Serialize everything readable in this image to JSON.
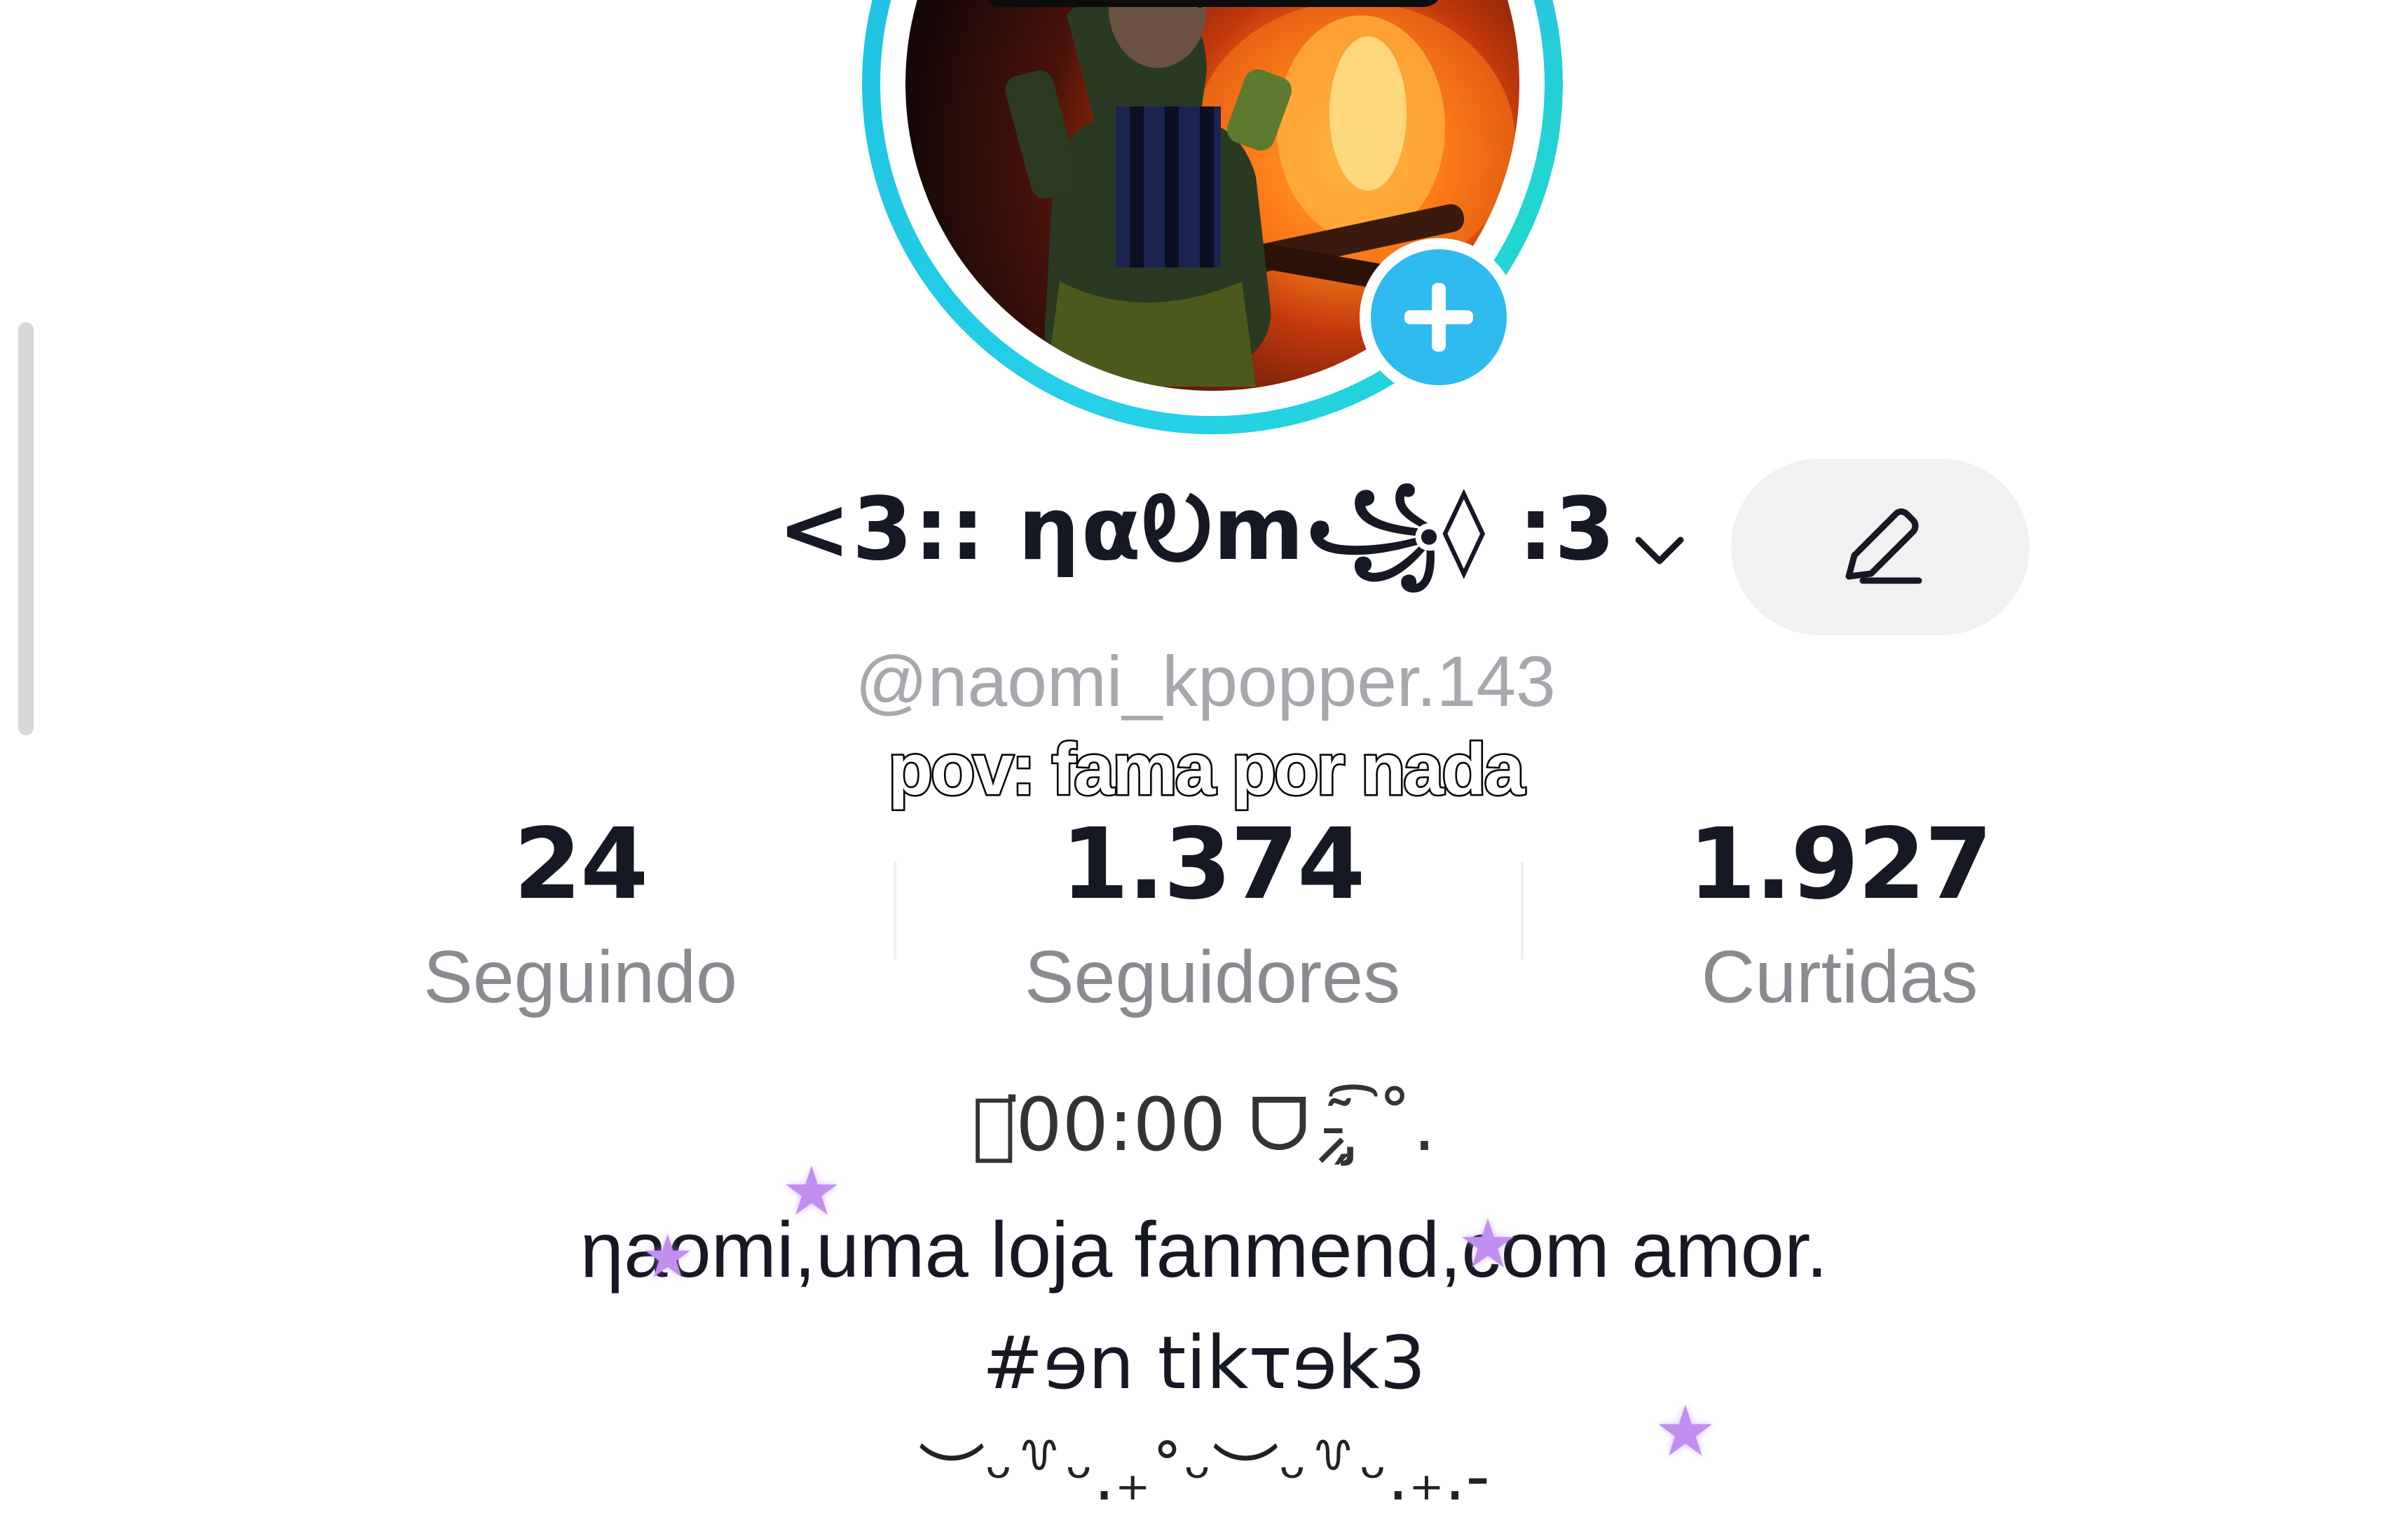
{
  "profile": {
    "display_name": "<3:: ηαᎧm꧁◊ :3",
    "username": "@naomi_kpopper.143",
    "add_icon": "plus-icon",
    "edit_icon": "pencil-icon",
    "dropdown_icon": "chevron-down-icon"
  },
  "caption": {
    "text": "pov: fama por nada"
  },
  "stats": {
    "following": {
      "value": "24",
      "label": "Seguindo"
    },
    "followers": {
      "value": "1.374",
      "label": "Seguidores"
    },
    "likes": {
      "value": "1.927",
      "label": "Curtidas"
    }
  },
  "bio": {
    "line1": "ศ͘00:00 ᗜ⸝̵̡̗͂͡ ˚.",
    "line2": "ηaomi,uma loja fanmend,com amor.",
    "line3": "#ɘn tikτɘk3",
    "line4": "︶ᵕ꒷ᵕ.₊˚ᵕ︶ᵕ꒷ᵕ.₊.-"
  },
  "colors": {
    "ring": "#25d0e8",
    "add_button": "#2fbbf0",
    "stars": "#c18ff0",
    "muted_text": "#8a8b91"
  }
}
